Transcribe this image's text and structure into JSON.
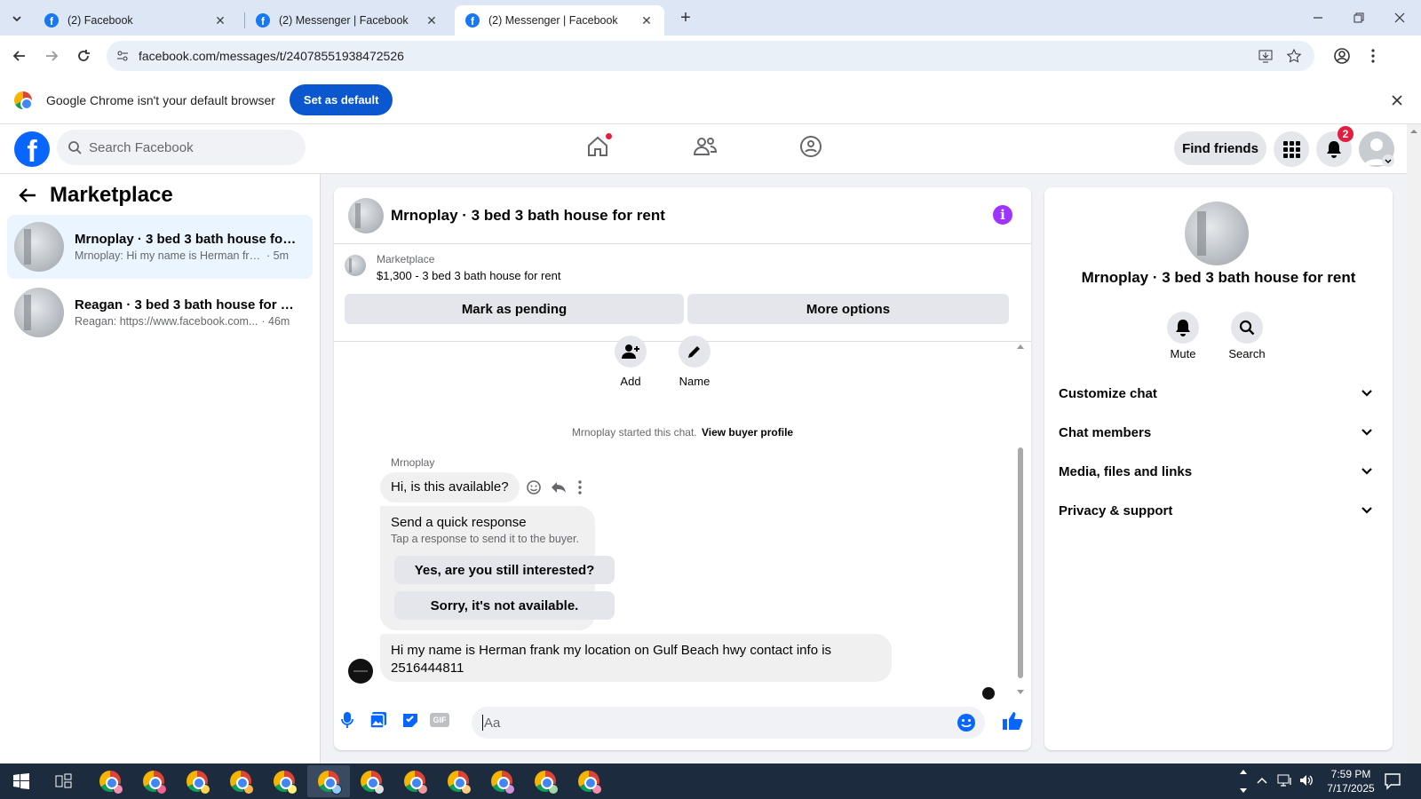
{
  "browser": {
    "tabs": [
      {
        "title": "(2) Facebook"
      },
      {
        "title": "(2) Messenger | Facebook"
      },
      {
        "title": "(2) Messenger | Facebook"
      }
    ],
    "url": "facebook.com/messages/t/24078551938472526",
    "infobar": {
      "message": "Google Chrome isn't your default browser",
      "button": "Set as default"
    }
  },
  "header": {
    "search_placeholder": "Search Facebook",
    "find_friends": "Find friends",
    "notification_count": "2"
  },
  "sidebar": {
    "title": "Marketplace",
    "conversations": [
      {
        "name": "Mrnoplay · 3 bed 3 bath house for...",
        "preview": "Mrnoplay: Hi my name is Herman fra...",
        "time": "· 5m"
      },
      {
        "name": "Reagan · 3 bed 3 bath house for re...",
        "preview": "Reagan: https://www.facebook.com...",
        "time": "· 46m"
      }
    ]
  },
  "chat": {
    "title": "Mrnoplay · 3 bed 3 bath house for rent",
    "marketplace_label": "Marketplace",
    "listing": "$1,300 - 3 bed 3 bath house for rent",
    "mark_pending": "Mark as pending",
    "more_options": "More options",
    "add_label": "Add",
    "name_label": "Name",
    "started_text": "Mrnoplay started this chat.",
    "view_profile": "View buyer profile",
    "sender": "Mrnoplay",
    "message1": "Hi, is this available?",
    "quick_title": "Send a quick response",
    "quick_sub": "Tap a response to send it to the buyer.",
    "quick_reply1": "Yes, are you still interested?",
    "quick_reply2": "Sorry, it's not available.",
    "message2": "Hi my name is Herman frank  my location on Gulf Beach hwy  contact info is 2516444811",
    "input_placeholder": "Aa",
    "gif_label": "GIF"
  },
  "details": {
    "title": "Mrnoplay · 3 bed 3 bath house for rent",
    "mute": "Mute",
    "search": "Search",
    "sections": [
      "Customize chat",
      "Chat members",
      "Media, files and links",
      "Privacy & support"
    ]
  },
  "taskbar": {
    "time": "7:59 PM",
    "date": "7/17/2025"
  },
  "colors": {
    "brand": "#0866ff",
    "accent_purple": "#a033ff",
    "notification": "#e41e3f"
  }
}
